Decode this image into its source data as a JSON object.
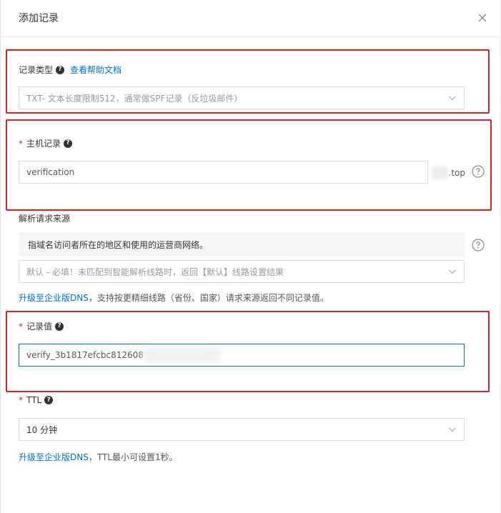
{
  "dialog": {
    "title": "添加记录"
  },
  "record_type": {
    "label": "记录类型",
    "help_link": "查看帮助文档",
    "selected": "TXT- 文本长度限制512，通常做SPF记录（反垃圾邮件）"
  },
  "host_record": {
    "required_mark": "*",
    "label": "主机记录",
    "value": "verification",
    "suffix": ".top"
  },
  "resolve_source": {
    "label": "解析请求来源",
    "notice": "指域名访问者所在的地区和使用的运营商网络。",
    "selected": "默认 - 必填！未匹配到智能解析线路时，返回【默认】线路设置结果",
    "upgrade_link": "升级至企业版DNS",
    "upgrade_text": "，支持按更精细线路（省份、国家）请求来源返回不同记录值。"
  },
  "record_value": {
    "required_mark": "*",
    "label": "记录值",
    "value": "verify_3b1817efcbc812608"
  },
  "ttl": {
    "required_mark": "*",
    "label": "TTL",
    "selected": "10 分钟",
    "upgrade_link": "升级至企业版DNS",
    "upgrade_text": "，TTL最小可设置1秒。"
  },
  "icons": {
    "help": "question-circle-icon",
    "close": "close-icon",
    "dropdown": "chevron-down-icon"
  },
  "colors": {
    "link": "#0070cc",
    "required": "#e02020",
    "highlight_box": "#e02020",
    "focus_border": "#0070cc"
  }
}
